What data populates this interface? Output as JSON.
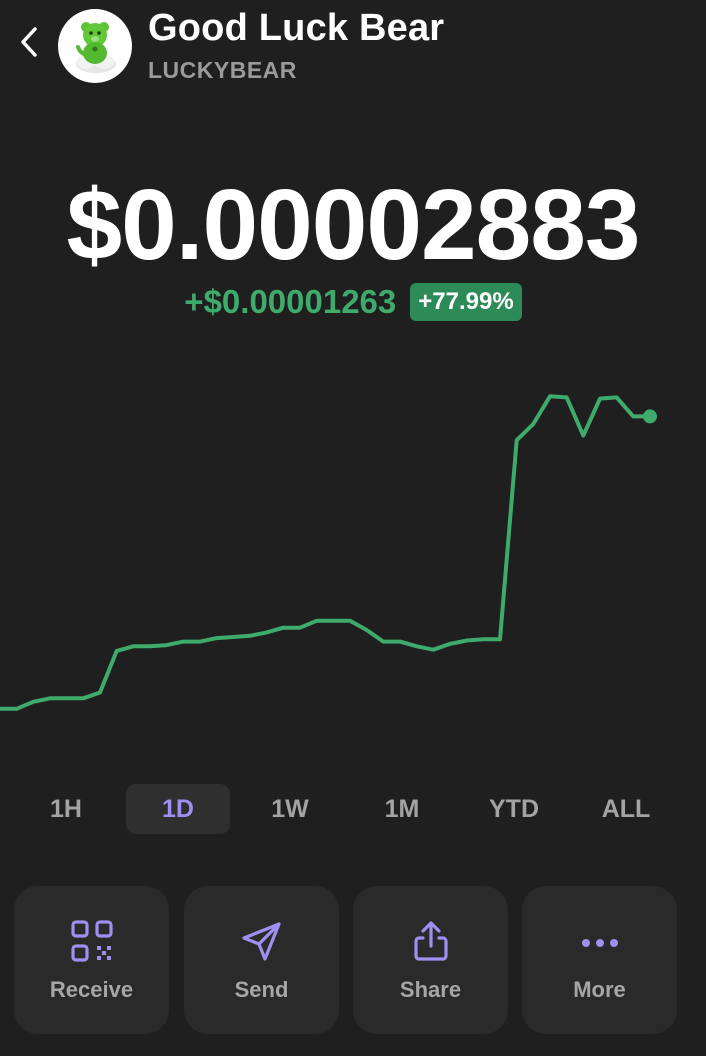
{
  "header": {
    "token_name": "Good Luck Bear",
    "token_symbol": "LUCKYBEAR",
    "back_icon": "chevron-left-icon",
    "avatar_icon": "lucky-bear-logo"
  },
  "price": {
    "value": "$0.00002883",
    "change_abs": "+$0.00001263",
    "change_pct": "+77.99%"
  },
  "colors": {
    "background": "#1f1f1f",
    "positive": "#3eaa6c",
    "badge": "#2d8b57",
    "accent": "#a08ff0",
    "card": "#2a2a2a",
    "muted_text": "#a3a3a3"
  },
  "chart_data": {
    "type": "line",
    "series": [
      {
        "values": [
          1.62e-05,
          1.62e-05,
          1.65e-05,
          1.665e-05,
          1.665e-05,
          1.665e-05,
          1.69e-05,
          1.87e-05,
          1.89e-05,
          1.89e-05,
          1.895e-05,
          1.91e-05,
          1.91e-05,
          1.925e-05,
          1.93e-05,
          1.935e-05,
          1.95e-05,
          1.97e-05,
          1.97e-05,
          2e-05,
          2e-05,
          2e-05,
          1.96e-05,
          1.91e-05,
          1.91e-05,
          1.89e-05,
          1.875e-05,
          1.9e-05,
          1.915e-05,
          1.92e-05,
          1.92e-05,
          2.78e-05,
          2.85e-05,
          2.97e-05,
          2.965e-05,
          2.8e-05,
          2.96e-05,
          2.965e-05,
          2.883e-05,
          2.883e-05
        ]
      }
    ],
    "timeframe": "1D"
  },
  "ranges": {
    "items": [
      "1H",
      "1D",
      "1W",
      "1M",
      "YTD",
      "ALL"
    ],
    "selected": "1D"
  },
  "actions": [
    {
      "label": "Receive",
      "icon": "qr-code-icon"
    },
    {
      "label": "Send",
      "icon": "send-icon"
    },
    {
      "label": "Share",
      "icon": "share-icon"
    },
    {
      "label": "More",
      "icon": "more-icon"
    }
  ]
}
